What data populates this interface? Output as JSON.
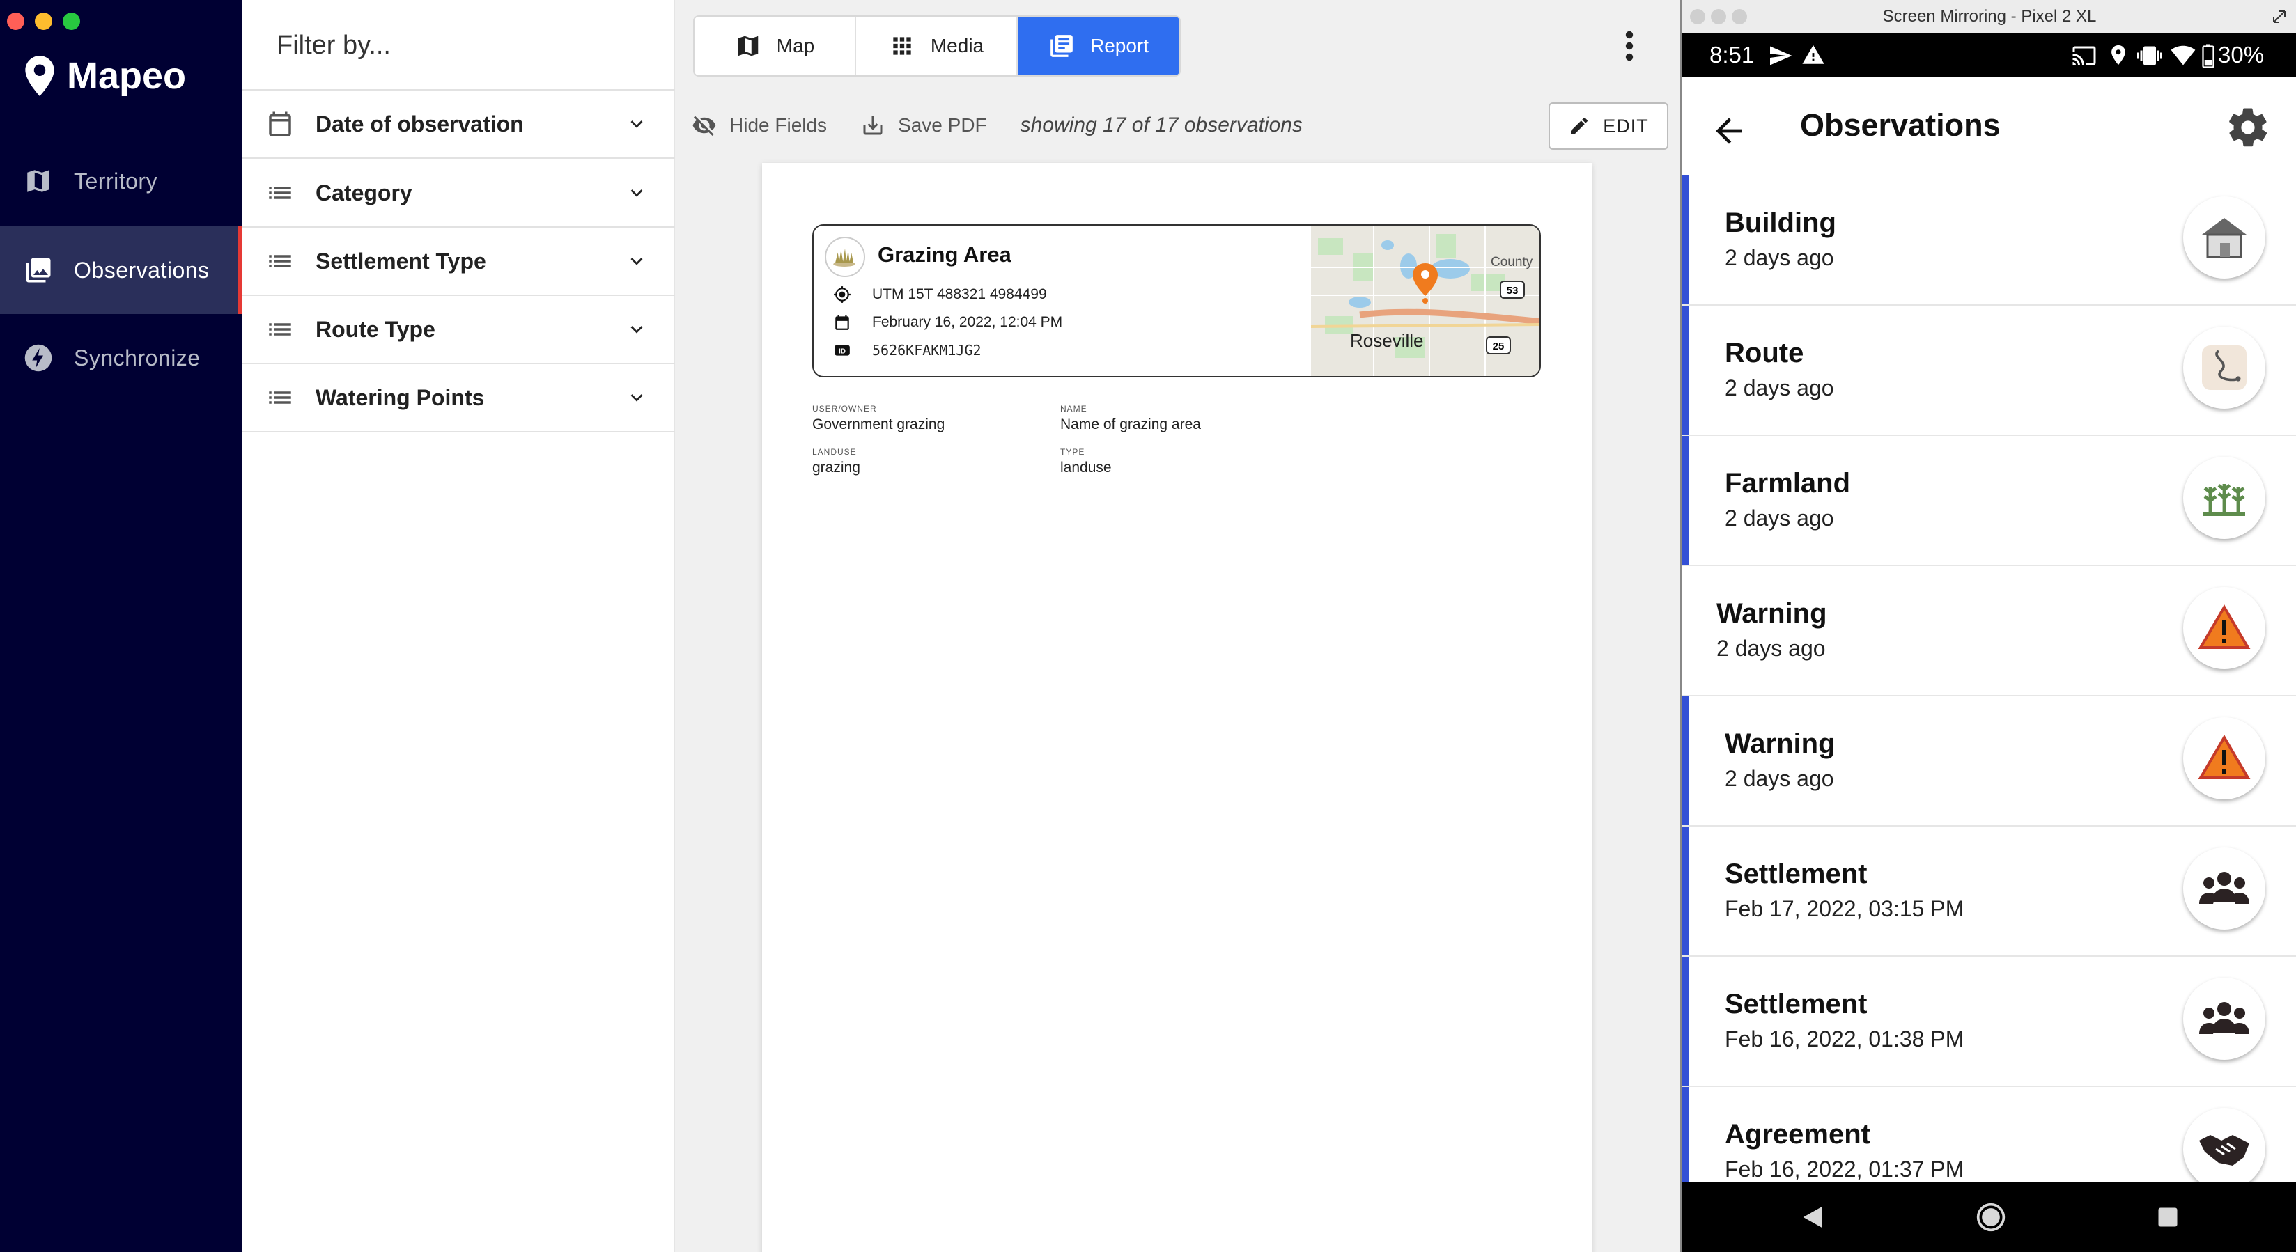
{
  "app": {
    "name": "Mapeo"
  },
  "sidebar": {
    "items": [
      {
        "label": "Territory",
        "icon": "map-icon"
      },
      {
        "label": "Observations",
        "icon": "photo-library-icon",
        "active": true
      },
      {
        "label": "Synchronize",
        "icon": "bolt-icon"
      }
    ]
  },
  "filters": {
    "title": "Filter by...",
    "items": [
      {
        "label": "Date of observation",
        "icon": "calendar-icon"
      },
      {
        "label": "Category",
        "icon": "list-icon"
      },
      {
        "label": "Settlement Type",
        "icon": "list-icon"
      },
      {
        "label": "Route Type",
        "icon": "list-icon"
      },
      {
        "label": "Watering Points",
        "icon": "list-icon"
      }
    ]
  },
  "tabs": [
    {
      "label": "Map",
      "icon": "map-icon"
    },
    {
      "label": "Media",
      "icon": "grid-icon"
    },
    {
      "label": "Report",
      "icon": "report-icon",
      "active": true
    }
  ],
  "toolbar": {
    "hide_fields": "Hide Fields",
    "save_pdf": "Save PDF",
    "showing": "showing 17 of 17 observations",
    "edit": "EDIT"
  },
  "report": {
    "title": "Grazing Area",
    "location": "UTM 15T 488321 4984499",
    "date": "February 16, 2022, 12:04 PM",
    "id": "5626KFAKM1JG2",
    "map": {
      "place": "Roseville",
      "county": "County",
      "route1": "53",
      "route2": "25"
    },
    "fields": [
      {
        "label": "USER/OWNER",
        "value": "Government grazing"
      },
      {
        "label": "NAME",
        "value": "Name of grazing area"
      },
      {
        "label": "LANDUSE",
        "value": "grazing"
      },
      {
        "label": "TYPE",
        "value": "landuse"
      }
    ]
  },
  "mirroring": {
    "window_title": "Screen Mirroring - Pixel 2 XL",
    "time": "8:51",
    "battery": "30%",
    "screen_title": "Observations",
    "observations": [
      {
        "title": "Building",
        "date": "2 days ago",
        "icon": "building-icon",
        "synced": true
      },
      {
        "title": "Route",
        "date": "2 days ago",
        "icon": "route-icon",
        "synced": true
      },
      {
        "title": "Farmland",
        "date": "2 days ago",
        "icon": "farmland-icon",
        "synced": true
      },
      {
        "title": "Warning",
        "date": "2 days ago",
        "icon": "warning-icon",
        "synced": false
      },
      {
        "title": "Warning",
        "date": "2 days ago",
        "icon": "warning-icon",
        "synced": true
      },
      {
        "title": "Settlement",
        "date": "Feb 17, 2022, 03:15 PM",
        "icon": "people-icon",
        "synced": true
      },
      {
        "title": "Settlement",
        "date": "Feb 16, 2022, 01:38 PM",
        "icon": "people-icon",
        "synced": true
      },
      {
        "title": "Agreement",
        "date": "Feb 16, 2022, 01:37 PM",
        "icon": "handshake-icon",
        "synced": true
      }
    ]
  },
  "colors": {
    "sidebar": "#000033",
    "accent": "#2f6ef0",
    "sync_bar": "#3350d6",
    "marker": "#f07b1e"
  }
}
